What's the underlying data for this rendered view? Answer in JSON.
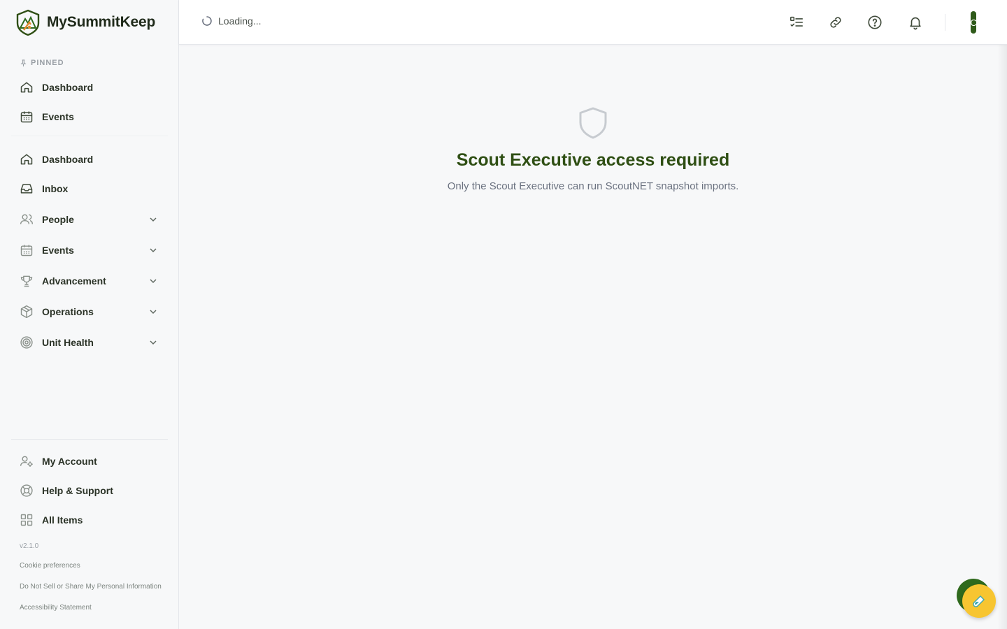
{
  "brand": {
    "name": "MySummitKeep",
    "logo_icon": "mountain-shield-logo"
  },
  "sidebar": {
    "pinned_label": "PINNED",
    "pinned": [
      {
        "label": "Dashboard",
        "icon": "home-icon"
      },
      {
        "label": "Events",
        "icon": "calendar-icon"
      }
    ],
    "items": [
      {
        "label": "Dashboard",
        "icon": "home-icon",
        "expandable": false
      },
      {
        "label": "Inbox",
        "icon": "inbox-icon",
        "expandable": false
      },
      {
        "label": "People",
        "icon": "users-icon",
        "expandable": true
      },
      {
        "label": "Events",
        "icon": "calendar-icon",
        "expandable": true
      },
      {
        "label": "Advancement",
        "icon": "trophy-icon",
        "expandable": true
      },
      {
        "label": "Operations",
        "icon": "package-icon",
        "expandable": true
      },
      {
        "label": "Unit Health",
        "icon": "target-icon",
        "expandable": true
      }
    ],
    "bottom": [
      {
        "label": "My Account",
        "icon": "user-gear-icon"
      },
      {
        "label": "Help & Support",
        "icon": "lifebuoy-icon"
      },
      {
        "label": "All Items",
        "icon": "grid-icon"
      }
    ],
    "version": "v2.1.0",
    "footer_links": [
      "Cookie preferences",
      "Do Not Sell or Share My Personal Information",
      "Accessibility Statement"
    ]
  },
  "topbar": {
    "loading_text": "Loading...",
    "icons": [
      "checklist-icon",
      "link-icon",
      "help-icon",
      "bell-icon"
    ],
    "avatar_initial": "C"
  },
  "main": {
    "title": "Scout Executive access required",
    "subtitle": "Only the Scout Executive can run ScoutNET snapshot imports.",
    "icon": "shield-icon"
  },
  "colors": {
    "brand_green": "#2f4f14",
    "fab_green": "#2f6a1d",
    "fab_yellow": "#f7c531"
  }
}
